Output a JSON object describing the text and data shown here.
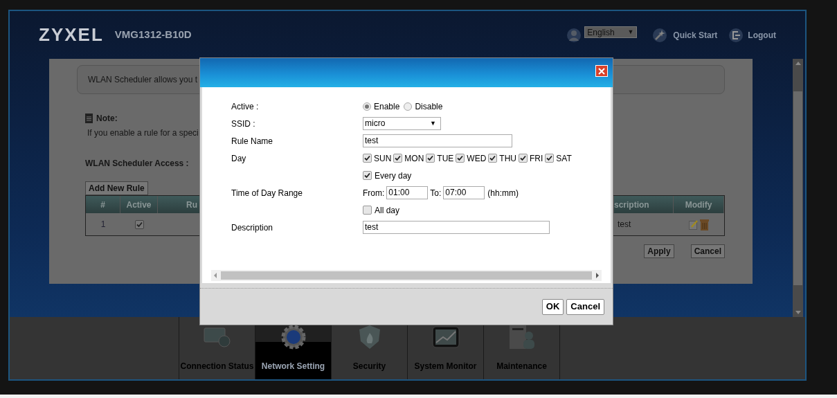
{
  "header": {
    "brand": "ZYXEL",
    "model": "VMG1312-B10D",
    "language": "English",
    "language_caret": "▼",
    "quick_start": "Quick Start",
    "logout": "Logout"
  },
  "page": {
    "intro": "WLAN Scheduler allows you t",
    "note_title": "Note:",
    "note_text": "If you enable a rule for a speci",
    "access_title": "WLAN Scheduler Access :",
    "add_button": "Add New Rule",
    "table": {
      "columns": [
        "#",
        "Active",
        "Ru",
        "scription",
        "Modify"
      ],
      "rows": [
        {
          "number": "1",
          "active": true,
          "description": "test"
        }
      ]
    },
    "buttons": [
      "Apply",
      "Cancel"
    ]
  },
  "dialog": {
    "active": {
      "label": "Active :",
      "options": [
        {
          "label": "Enable",
          "selected": true
        },
        {
          "label": "Disable",
          "selected": false
        }
      ]
    },
    "ssid": {
      "label": "SSID :",
      "value": "micro",
      "caret": "▼"
    },
    "rule_name": {
      "label": "Rule Name",
      "value": "test"
    },
    "day": {
      "label": "Day",
      "days": [
        {
          "label": "SUN",
          "checked": true
        },
        {
          "label": "MON",
          "checked": true
        },
        {
          "label": "TUE",
          "checked": true
        },
        {
          "label": "WED",
          "checked": true
        },
        {
          "label": "THU",
          "checked": true
        },
        {
          "label": "FRI",
          "checked": true
        },
        {
          "label": "SAT",
          "checked": true
        }
      ],
      "every_day": {
        "label": "Every day",
        "checked": true
      }
    },
    "time": {
      "label": "Time of Day Range",
      "from_label": "From:",
      "from": "01:00",
      "to_label": "To:",
      "to": "07:00",
      "unit": "(hh:mm)",
      "all_day": {
        "label": "All day",
        "checked": false
      }
    },
    "description": {
      "label": "Description",
      "value": "test"
    },
    "buttons": [
      "OK",
      "Cancel"
    ]
  },
  "nav": [
    {
      "label": "Connection Status",
      "selected": false
    },
    {
      "label": "Network Setting",
      "selected": true
    },
    {
      "label": "Security",
      "selected": false
    },
    {
      "label": "System Monitor",
      "selected": false
    },
    {
      "label": "Maintenance",
      "selected": false
    }
  ]
}
